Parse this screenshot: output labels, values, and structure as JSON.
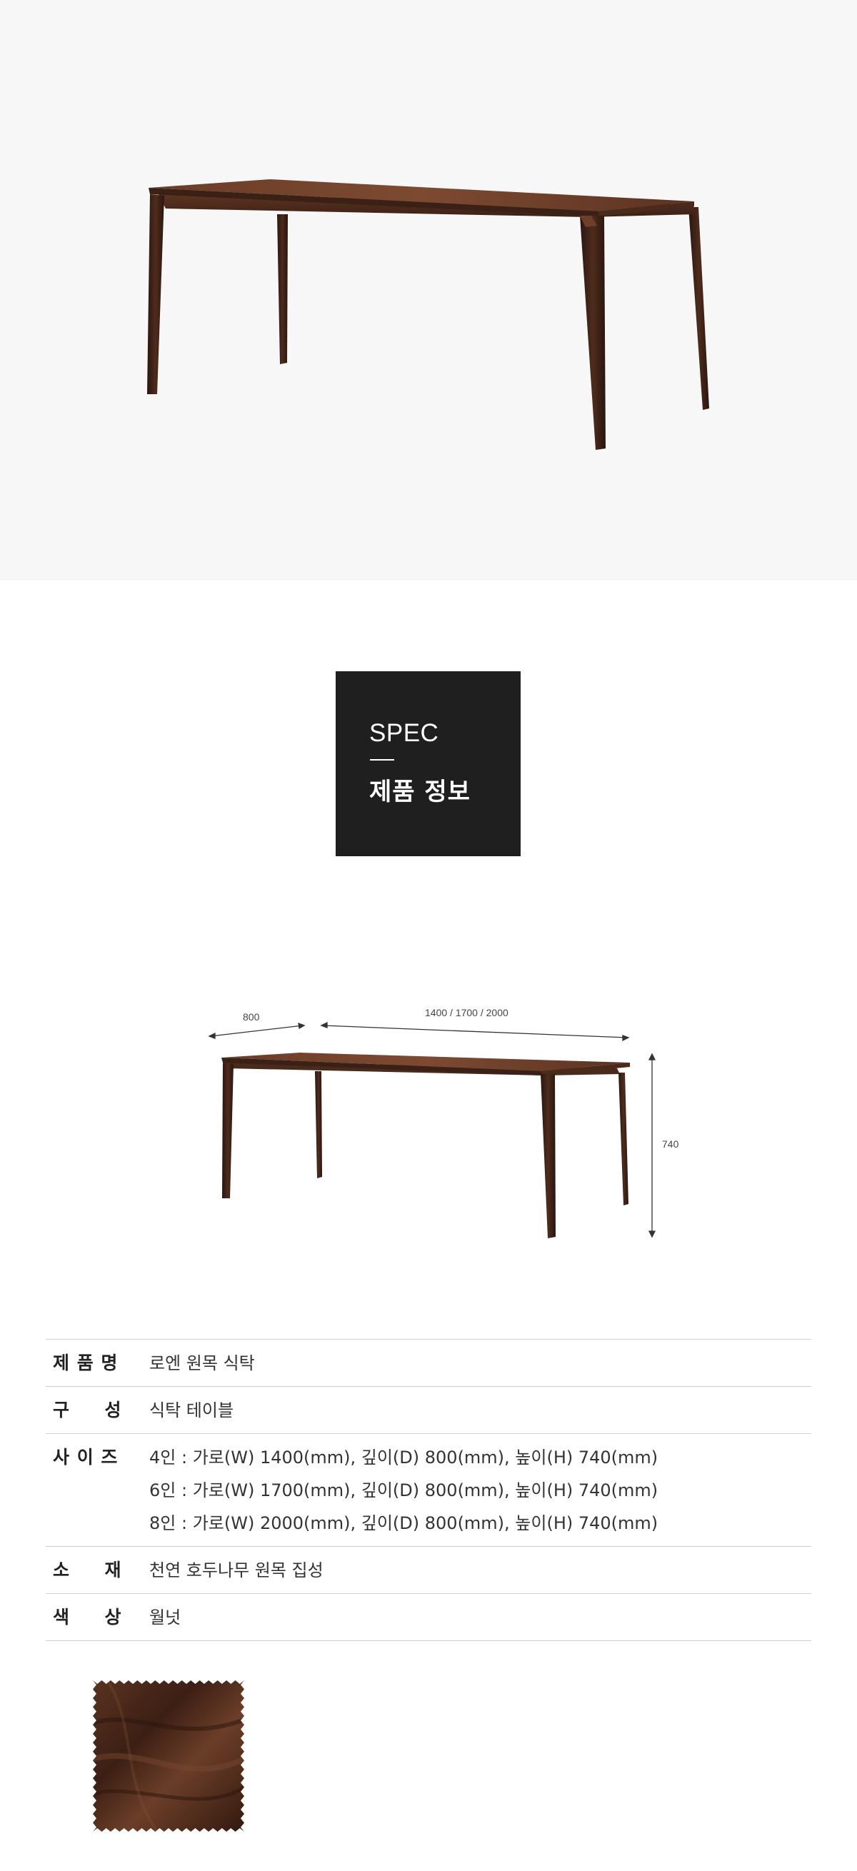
{
  "spec_badge": {
    "title_en": "SPEC",
    "title_ko": "제품 정보"
  },
  "dimensions": {
    "depth": "800",
    "width": "1400 / 1700 / 2000",
    "height": "740"
  },
  "spec_table": [
    {
      "label": "제 품 명",
      "values": [
        "로엔 원목 식탁"
      ]
    },
    {
      "label": "구     성",
      "values": [
        "식탁 테이블"
      ]
    },
    {
      "label": "사 이 즈",
      "values": [
        "4인 : 가로(W) 1400(mm), 깊이(D) 800(mm), 높이(H) 740(mm)",
        "6인 : 가로(W) 1700(mm), 깊이(D) 800(mm), 높이(H) 740(mm)",
        "8인 : 가로(W) 2000(mm), 깊이(D) 800(mm), 높이(H) 740(mm)"
      ]
    },
    {
      "label": "소     재",
      "values": [
        "천연 호두나무 원목 집성"
      ]
    },
    {
      "label": "색     상",
      "values": [
        "월넛"
      ]
    }
  ],
  "colors": {
    "hero_bg": "#f7f7f8",
    "badge_bg": "#1f1f1f",
    "walnut_dark": "#3a1f14",
    "walnut_mid": "#5a3322",
    "walnut_light": "#7a4a32",
    "rule": "#cfcfcf"
  }
}
